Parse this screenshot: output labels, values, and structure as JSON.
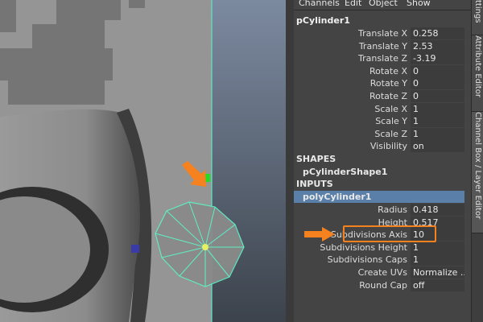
{
  "menu": [
    "Channels",
    "Edit",
    "Object",
    "Show"
  ],
  "node": "pCylinder1",
  "transform": [
    {
      "label": "Translate X",
      "value": "0.258"
    },
    {
      "label": "Translate Y",
      "value": "2.53"
    },
    {
      "label": "Translate Z",
      "value": "-3.19"
    },
    {
      "label": "Rotate X",
      "value": "0"
    },
    {
      "label": "Rotate Y",
      "value": "0"
    },
    {
      "label": "Rotate Z",
      "value": "0"
    },
    {
      "label": "Scale X",
      "value": "1"
    },
    {
      "label": "Scale Y",
      "value": "1"
    },
    {
      "label": "Scale Z",
      "value": "1"
    },
    {
      "label": "Visibility",
      "value": "on"
    }
  ],
  "shapes_header": "SHAPES",
  "shape_node": "pCylinderShape1",
  "inputs_header": "INPUTS",
  "input_node": "polyCylinder1",
  "inputs": [
    {
      "label": "Radius",
      "value": "0.418"
    },
    {
      "label": "Height",
      "value": "0.517"
    },
    {
      "label": "Subdivisions Axis",
      "value": "10"
    },
    {
      "label": "Subdivisions Height",
      "value": "1"
    },
    {
      "label": "Subdivisions Caps",
      "value": "1"
    },
    {
      "label": "Create UVs",
      "value": "Normalize ..."
    },
    {
      "label": "Round Cap",
      "value": "off"
    }
  ],
  "tabs": [
    "ttings",
    "Attribute Editor",
    "Channel Box / Layer Editor"
  ],
  "colors": {
    "accent": "#f5821f",
    "selected_row": "#5a7fa8",
    "wireframe": "#5ef0c4"
  },
  "icons": [
    "orange-arrow-icon",
    "component-handle-icon"
  ]
}
